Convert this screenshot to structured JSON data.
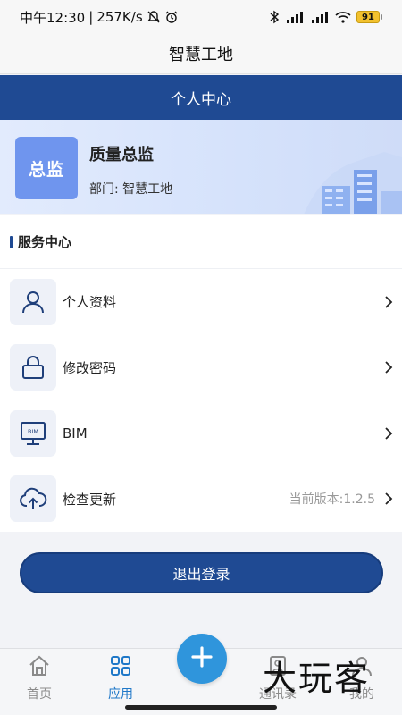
{
  "status_bar": {
    "time": "中午12:30",
    "separator": "|",
    "speed": "257K/s",
    "battery": "91"
  },
  "app": {
    "title": "智慧工地"
  },
  "header": {
    "title": "个人中心"
  },
  "profile": {
    "avatar_text": "总监",
    "name": "质量总监",
    "dept_label": "部门:",
    "dept_value": "智慧工地"
  },
  "services": {
    "title": "服务中心",
    "items": [
      {
        "label": "个人资料",
        "icon": "user-icon",
        "extra": ""
      },
      {
        "label": "修改密码",
        "icon": "lock-icon",
        "extra": ""
      },
      {
        "label": "BIM",
        "icon": "bim-monitor-icon",
        "extra": "",
        "icon_text": "BIM"
      },
      {
        "label": "检查更新",
        "icon": "cloud-upload-icon",
        "extra": "当前版本:1.2.5"
      }
    ]
  },
  "logout": {
    "label": "退出登录"
  },
  "tabs": [
    {
      "label": "首页",
      "icon": "home-icon",
      "active": false
    },
    {
      "label": "应用",
      "icon": "grid-icon",
      "active": true
    },
    {
      "label": "通讯录",
      "icon": "contacts-icon",
      "active": false
    },
    {
      "label": "我的",
      "icon": "user-tab-icon",
      "active": false
    }
  ],
  "watermark": "大玩客",
  "colors": {
    "primary": "#1f4a93",
    "tab_active": "#1f78c8",
    "fab": "#2f95dc",
    "avatar": "#6f95ee"
  }
}
